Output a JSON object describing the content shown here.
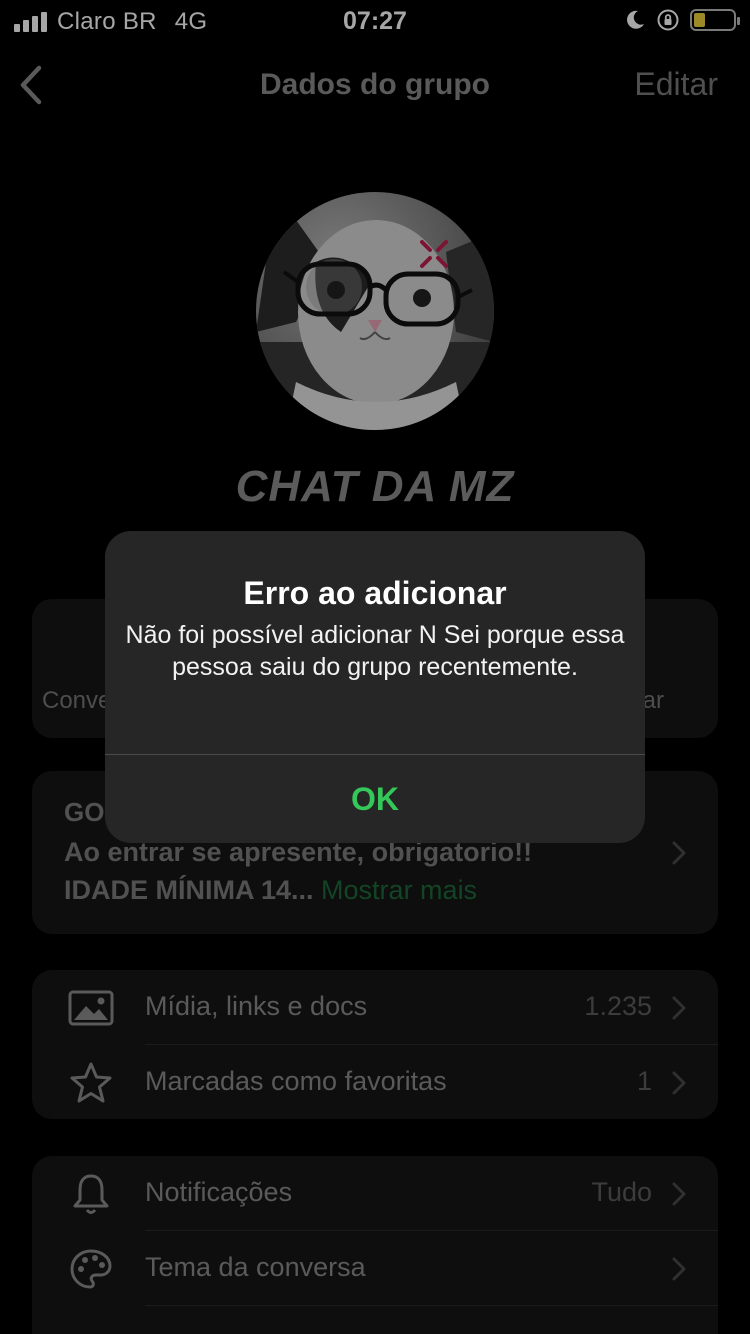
{
  "status_bar": {
    "carrier": "Claro BR",
    "network": "4G",
    "time": "07:27",
    "icons": [
      "signal-bars-icon",
      "moon-icon",
      "orientation-lock-icon",
      "battery-icon"
    ],
    "battery_color": "#f2d33a"
  },
  "nav": {
    "back_icon": "chevron-left-icon",
    "title": "Dados do grupo",
    "edit_label": "Editar"
  },
  "group": {
    "name": "CHAT DA MZ"
  },
  "actions": {
    "left_label_partial": "Conve",
    "right_label_partial": "ar"
  },
  "description": {
    "title_partial": "GO",
    "line1": "Ao entrar se apresente, obrigatorio!!",
    "line2": "IDADE MÍNIMA 14...",
    "more_label": "Mostrar mais",
    "more_color": "#1d6a39"
  },
  "media_section": {
    "items": [
      {
        "icon": "image-icon",
        "label": "Mídia, links e docs",
        "value": "1.235"
      },
      {
        "icon": "star-icon",
        "label": "Marcadas como favoritas",
        "value": "1"
      }
    ]
  },
  "settings_section": {
    "items": [
      {
        "icon": "bell-icon",
        "label": "Notificações",
        "value": "Tudo"
      },
      {
        "icon": "palette-icon",
        "label": "Tema da conversa",
        "value": ""
      }
    ]
  },
  "alert": {
    "title": "Erro ao adicionar",
    "message": "Não foi possível adicionar N Sei porque essa pessoa saiu do grupo recentemente.",
    "ok_label": "OK",
    "ok_color": "#34c759"
  }
}
